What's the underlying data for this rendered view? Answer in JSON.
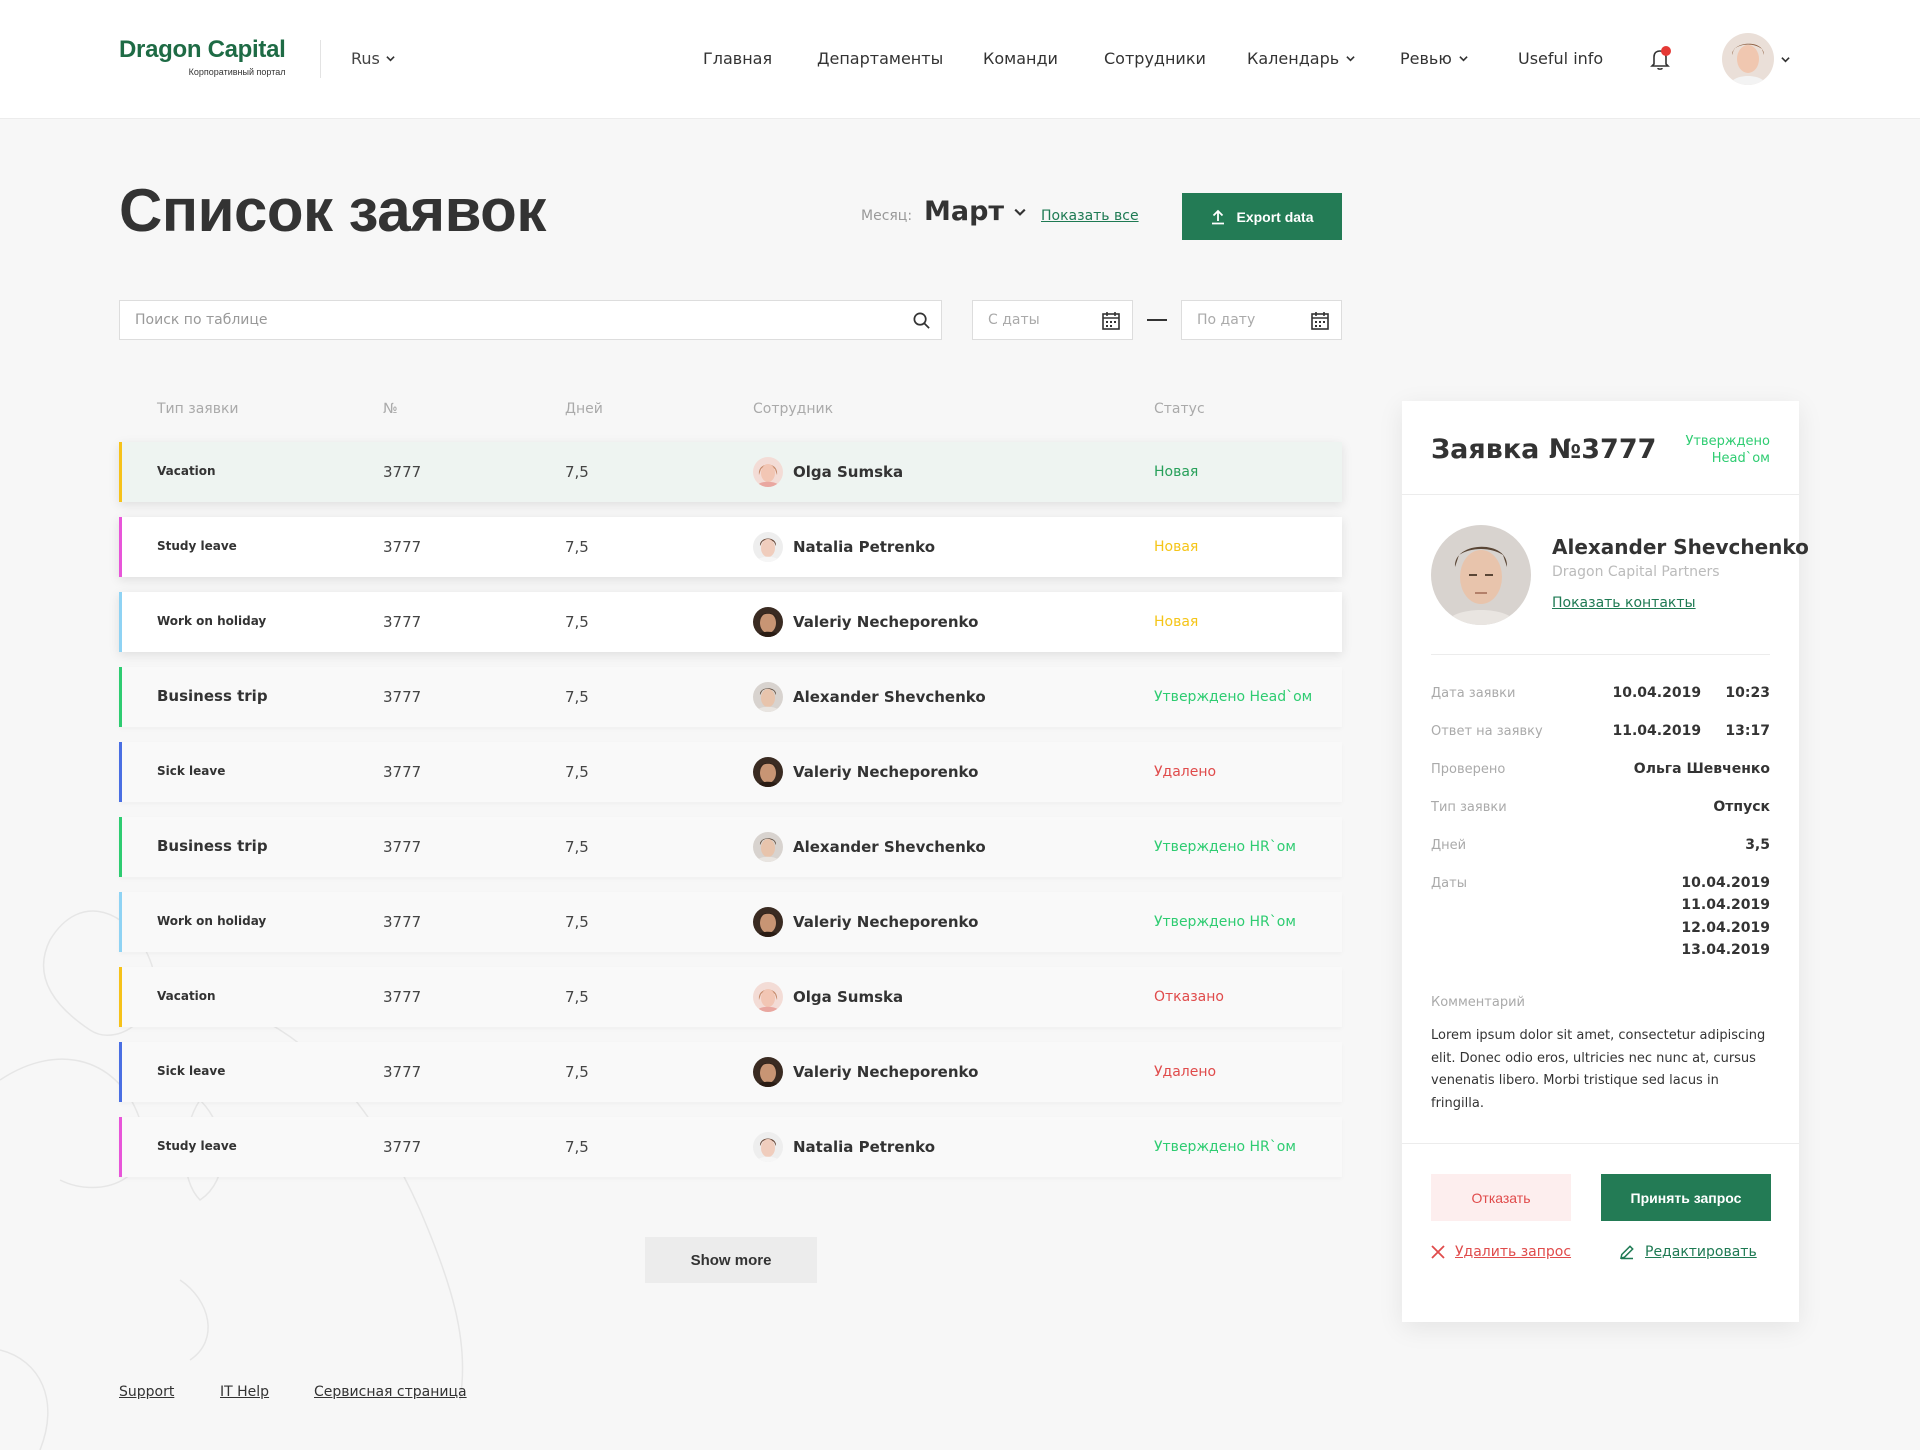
{
  "header": {
    "logo_text": "Dragon Capital",
    "logo_subtitle": "Корпоративный портал",
    "language": "Rus",
    "nav": [
      {
        "label": "Главная",
        "has_dropdown": false
      },
      {
        "label": "Департаменты",
        "has_dropdown": false
      },
      {
        "label": "Команди",
        "has_dropdown": false
      },
      {
        "label": "Сотрудники",
        "has_dropdown": false
      },
      {
        "label": "Календарь",
        "has_dropdown": true
      },
      {
        "label": "Ревью",
        "has_dropdown": true
      },
      {
        "label": "Useful info",
        "has_dropdown": false
      }
    ],
    "notification_dot_color": "#e53935"
  },
  "page": {
    "title": "Список заявок",
    "month_label": "Месяц:",
    "month_value": "Март",
    "show_all_label": "Показать все",
    "export_label": "Export data"
  },
  "filters": {
    "search_placeholder": "Поиск по таблице",
    "date_from_placeholder": "С даты",
    "date_to_placeholder": "По дату"
  },
  "table": {
    "columns": [
      "Тип заявки",
      "№",
      "Дней",
      "Сотрудник",
      "Статус"
    ],
    "rows": [
      {
        "type": "Vacation",
        "number": "3777",
        "days": "7,5",
        "employee": "Olga Sumska",
        "avatar": "olga",
        "status": "Новая",
        "status_color": "#27a05a",
        "bar_color": "#f6c21a",
        "style": "selected"
      },
      {
        "type": "Study leave",
        "number": "3777",
        "days": "7,5",
        "employee": "Natalia Petrenko",
        "avatar": "natalia",
        "status": "Новая",
        "status_color": "#f5c518",
        "bar_color": "#e855d9",
        "style": "raised"
      },
      {
        "type": "Work on holiday",
        "number": "3777",
        "days": "7,5",
        "employee": "Valeriy Necheporenko",
        "avatar": "valeriy",
        "status": "Новая",
        "status_color": "#f5c518",
        "bar_color": "#8fd3f4",
        "style": "raised"
      },
      {
        "type": "Business trip",
        "number": "3777",
        "days": "7,5",
        "employee": "Alexander Shevchenko",
        "avatar": "alex",
        "status": "Утверждено Head`ом",
        "status_color": "#2ecc71",
        "bar_color": "#2ecc71",
        "style": "faded"
      },
      {
        "type": "Sick leave",
        "number": "3777",
        "days": "7,5",
        "employee": "Valeriy Necheporenko",
        "avatar": "valeriy",
        "status": "Удалено",
        "status_color": "#e04b4b",
        "bar_color": "#4a6fe3",
        "style": "faded"
      },
      {
        "type": "Business trip",
        "number": "3777",
        "days": "7,5",
        "employee": "Alexander Shevchenko",
        "avatar": "alex",
        "status": "Утверждено HR`ом",
        "status_color": "#2ecc71",
        "bar_color": "#2ecc71",
        "style": "faded"
      },
      {
        "type": "Work on holiday",
        "number": "3777",
        "days": "7,5",
        "employee": "Valeriy Necheporenko",
        "avatar": "valeriy",
        "status": "Утверждено HR`ом",
        "status_color": "#2ecc71",
        "bar_color": "#8fd3f4",
        "style": "faded"
      },
      {
        "type": "Vacation",
        "number": "3777",
        "days": "7,5",
        "employee": "Olga Sumska",
        "avatar": "olga",
        "status": "Отказано",
        "status_color": "#e04b4b",
        "bar_color": "#f6c21a",
        "style": "faded"
      },
      {
        "type": "Sick leave",
        "number": "3777",
        "days": "7,5",
        "employee": "Valeriy Necheporenko",
        "avatar": "valeriy",
        "status": "Удалено",
        "status_color": "#e04b4b",
        "bar_color": "#4a6fe3",
        "style": "faded"
      },
      {
        "type": "Study leave",
        "number": "3777",
        "days": "7,5",
        "employee": "Natalia Petrenko",
        "avatar": "natalia",
        "status": "Утверждено HR`ом",
        "status_color": "#2ecc71",
        "bar_color": "#e855d9",
        "style": "faded"
      }
    ],
    "show_more_label": "Show more"
  },
  "footer": {
    "links": [
      "Support",
      "IT Help",
      "Сервисная страница"
    ]
  },
  "details": {
    "title": "Заявка №3777",
    "status": "Утверждено Head`ом",
    "person_name": "Alexander Shevchenko",
    "person_company": "Dragon Capital Partners",
    "contacts_label": "Показать контакты",
    "info": [
      {
        "label": "Дата заявки",
        "value": "10.04.2019     10:23"
      },
      {
        "label": "Ответ на заявку",
        "value": "11.04.2019     13:17"
      },
      {
        "label": "Проверено",
        "value": "Ольга Шевченко"
      },
      {
        "label": "Тип заявки",
        "value": "Отпуск"
      },
      {
        "label": "Дней",
        "value": "3,5"
      }
    ],
    "dates_label": "Даты",
    "dates": [
      "10.04.2019",
      "11.04.2019",
      "12.04.2019",
      "13.04.2019"
    ],
    "comment_label": "Комментарий",
    "comment": "Lorem ipsum dolor sit amet, consectetur adipiscing elit. Donec odio eros, ultricies nec nunc at, cursus venenatis libero. Morbi tristique sed lacus in fringilla.",
    "reject_label": "Отказать",
    "accept_label": "Принять запрос",
    "delete_label": "Удалить запрос",
    "edit_label": "Редактировать"
  },
  "colors": {
    "brand_green": "#237b55",
    "approved": "#2ecc71",
    "danger": "#e04b4b",
    "new_yellow": "#f5c518"
  }
}
